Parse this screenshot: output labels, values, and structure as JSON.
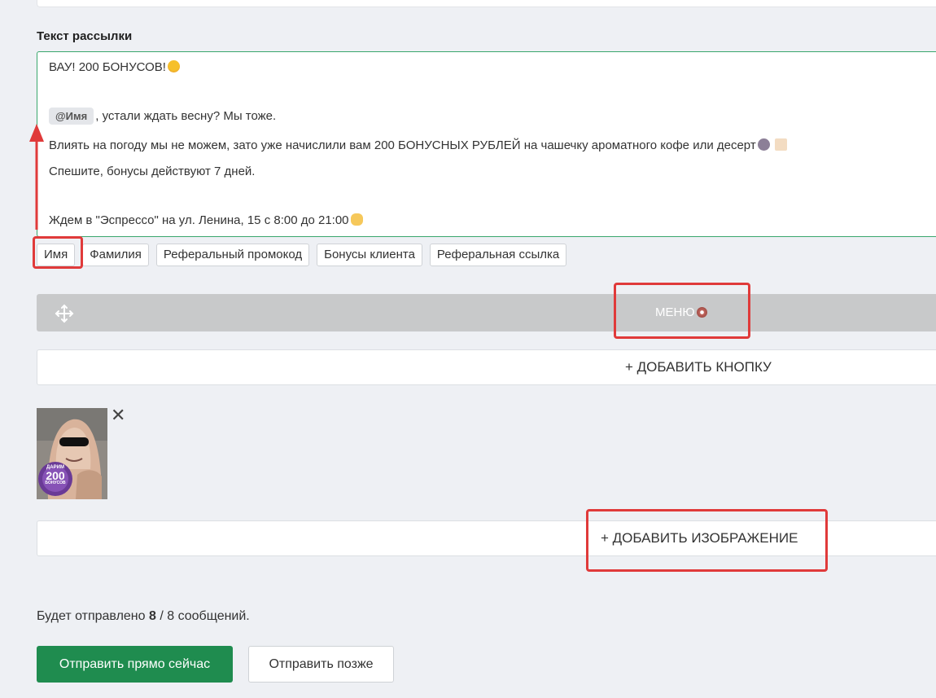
{
  "section_label": "Текст рассылки",
  "message": {
    "line1": "ВАУ! 200 БОНУСОВ!",
    "name_chip": "@Имя",
    "line2_rest": ", устали ждать весну? Мы тоже.",
    "line3": "Влиять на погоду мы не можем, зато уже начислили вам 200 БОНУСНЫХ РУБЛЕЙ на чашечку ароматного кофе или десерт",
    "line4": "Спешите, бонусы действуют 7 дней.",
    "line5": "Ждем в \"Эспрессо\" на ул. Ленина, 15 с 8:00 до 21:00"
  },
  "variables": [
    "Имя",
    "Фамилия",
    "Реферальный промокод",
    "Бонусы клиента",
    "Реферальная ссылка"
  ],
  "menu_block": {
    "label": "МЕНЮ"
  },
  "add_button_label": "+ ДОБАВИТЬ КНОПКУ",
  "image_badge": {
    "line1": "ДАРИМ",
    "line2": "200",
    "line3": "БОНУСОВ"
  },
  "close_symbol": "✕",
  "add_image_label": "+ ДОБАВИТЬ ИЗОБРАЖЕНИЕ",
  "summary": {
    "prefix": "Будет отправлено ",
    "count": "8",
    "suffix": " / 8 сообщений."
  },
  "send_now_label": "Отправить прямо сейчас",
  "send_later_label": "Отправить позже",
  "colors": {
    "accent_green": "#1f8c4f",
    "textarea_border": "#3aa76d",
    "highlight_red": "#e03a3a",
    "menu_bar_gray": "#c8c9ca"
  },
  "icons": [
    "move-icon",
    "star-struck-emoji-icon",
    "coffee-emoji-icon",
    "cake-emoji-icon",
    "heart-hands-emoji-icon",
    "donut-emoji-icon",
    "close-icon"
  ]
}
